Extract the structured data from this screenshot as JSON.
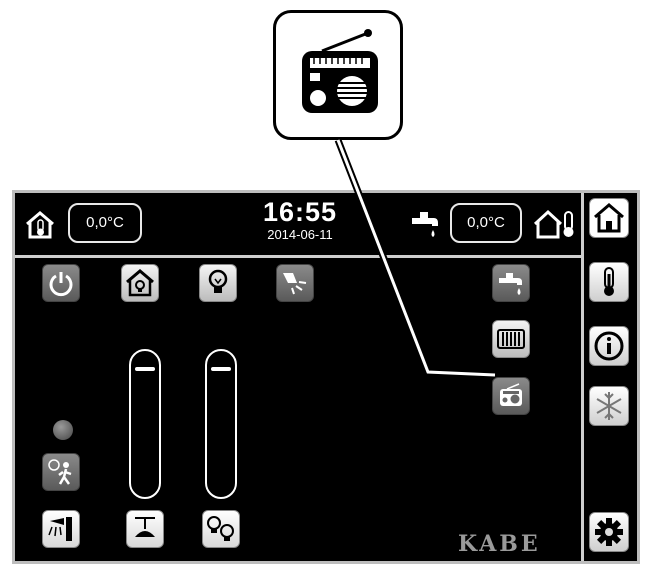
{
  "header": {
    "inside_temp": "0,0°C",
    "outside_temp": "0,0°C",
    "time": "16:55",
    "date": "2014-06-11"
  },
  "brand": "KABE",
  "icons": {
    "callout": "radio-icon",
    "inside_temp": "home-thermometer-icon",
    "outside_temp": "house-thermometer-icon",
    "water_heater": "faucet-drop-icon"
  },
  "sliders": [
    {
      "name": "ceiling-lamp-dimmer",
      "level": 0.9
    },
    {
      "name": "multi-lamp-dimmer",
      "level": 0.9
    }
  ],
  "colors": {
    "screen_bg": "#000000",
    "button": "#d0d0d0",
    "button_active": "#6e6e6e",
    "text": "#ffffff"
  }
}
